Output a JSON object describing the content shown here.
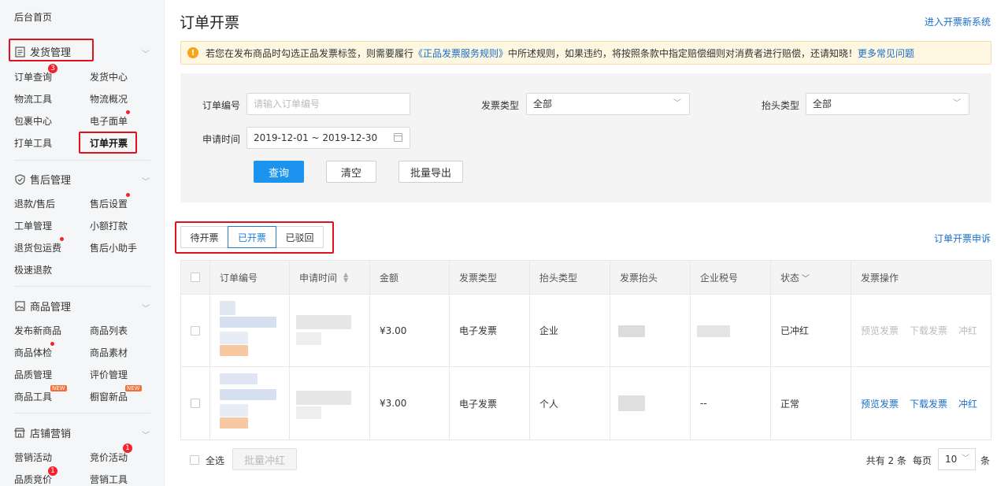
{
  "sidebar": {
    "home": "后台首页",
    "sections": [
      {
        "title": "发货管理",
        "icon": "document-icon",
        "items": [
          "订单查询",
          "发货中心",
          "物流工具",
          "物流概况",
          "包裹中心",
          "电子面单",
          "打单工具",
          "订单开票"
        ]
      },
      {
        "title": "售后管理",
        "icon": "shield-check-icon",
        "items": [
          "退款/售后",
          "售后设置",
          "工单管理",
          "小额打款",
          "退货包运费",
          "售后小助手",
          "极速退款"
        ]
      },
      {
        "title": "商品管理",
        "icon": "image-icon",
        "items": [
          "发布新商品",
          "商品列表",
          "商品体检",
          "商品素材",
          "品质管理",
          "评价管理",
          "商品工具",
          "橱窗新品"
        ]
      },
      {
        "title": "店铺营销",
        "icon": "shop-icon",
        "items": [
          "营销活动",
          "竞价活动",
          "品质竞价",
          "营销工具"
        ]
      }
    ],
    "badges": {
      "order_query": "3",
      "bidding": "1",
      "quality_bid": "1"
    },
    "new_tag": "NEW"
  },
  "header": {
    "title": "订单开票",
    "link": "进入开票新系统"
  },
  "notice": {
    "text_before": "若您在发布商品时勾选正品发票标签，则需要履行",
    "link_rule": "《正品发票服务规则》",
    "text_after": "中所述规则，如果违约，将按照条款中指定赔偿细则对消费者进行赔偿，还请知晓！",
    "link_faq": "更多常见问题"
  },
  "filter": {
    "order_no_label": "订单编号",
    "order_no_placeholder": "请输入订单编号",
    "invoice_type_label": "发票类型",
    "invoice_type_value": "全部",
    "title_type_label": "抬头类型",
    "title_type_value": "全部",
    "apply_time_label": "申请时间",
    "apply_time_value": "2019-12-01 ~ 2019-12-30",
    "query": "查询",
    "clear": "清空",
    "export": "批量导出"
  },
  "tabs": [
    "待开票",
    "已开票",
    "已驳回"
  ],
  "appeal_link": "订单开票申诉",
  "table": {
    "columns": [
      "订单编号",
      "申请时间",
      "金额",
      "发票类型",
      "抬头类型",
      "发票抬头",
      "企业税号",
      "状态",
      "发票操作"
    ],
    "rows": [
      {
        "amount": "¥3.00",
        "invoice_type": "电子发票",
        "title_type": "企业",
        "tax_no": "",
        "status": "已冲红",
        "ops": [
          "预览发票",
          "下载发票",
          "冲红"
        ]
      },
      {
        "amount": "¥3.00",
        "invoice_type": "电子发票",
        "title_type": "个人",
        "tax_no": "--",
        "status": "正常",
        "ops": [
          "预览发票",
          "下载发票",
          "冲红"
        ]
      }
    ]
  },
  "footer": {
    "select_all": "全选",
    "batch_red": "批量冲红",
    "total": "共有 2 条",
    "per_page_label": "每页",
    "per_page": "10",
    "unit": "条"
  },
  "colors": {
    "accent": "#1d93f0",
    "link": "#1a6fc9",
    "danger": "#e0121f"
  }
}
